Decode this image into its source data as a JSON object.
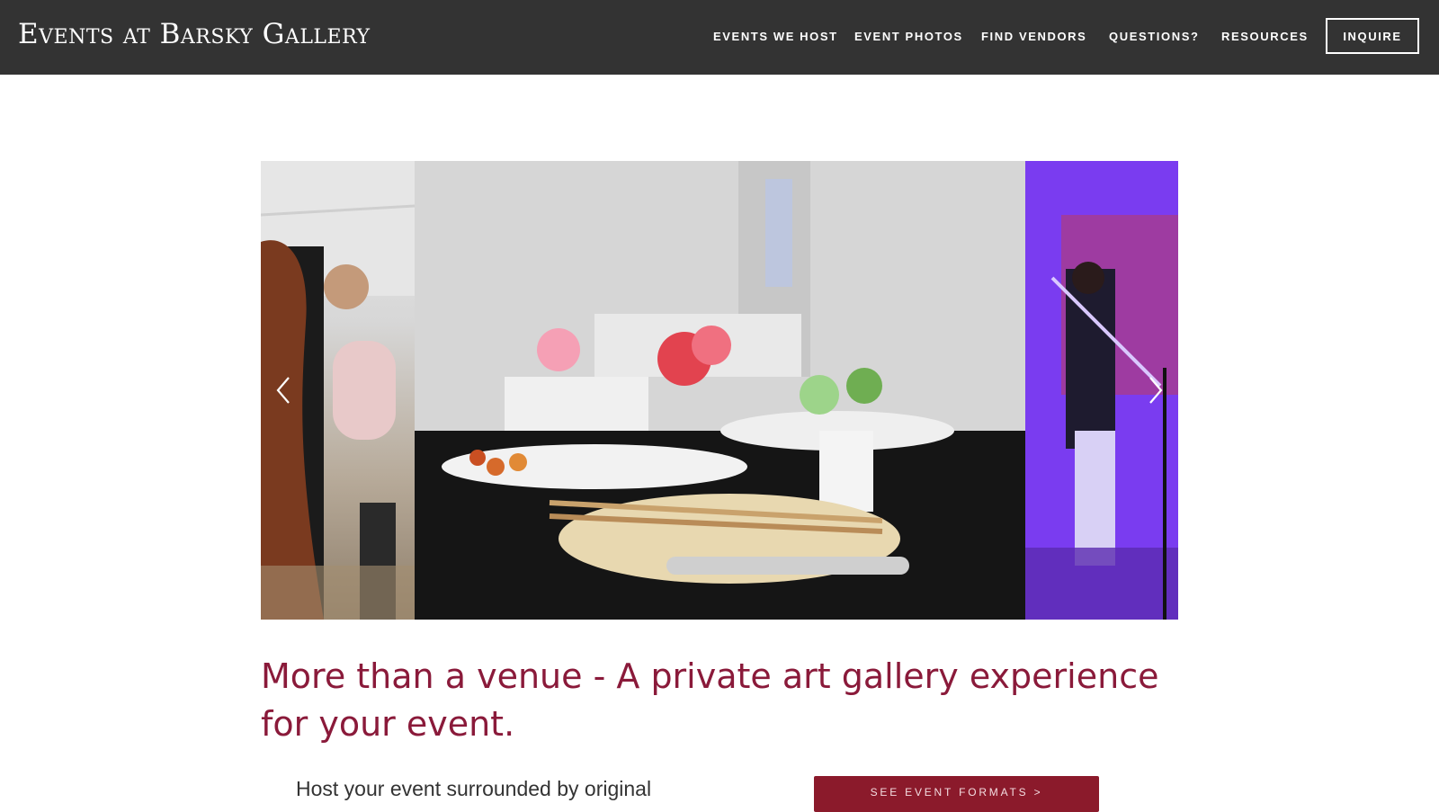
{
  "header": {
    "brand": "Events at Barsky Gallery",
    "nav": [
      {
        "label": "EVENTS WE HOST"
      },
      {
        "label": "EVENT PHOTOS"
      },
      {
        "label": "FIND VENDORS"
      },
      {
        "label": "QUESTIONS?"
      },
      {
        "label": "RESOURCES"
      }
    ],
    "inquire_label": "INQUIRE"
  },
  "carousel": {
    "slides": [
      {
        "name": "guests-seated"
      },
      {
        "name": "catering-buffet"
      },
      {
        "name": "trombone-performer"
      }
    ],
    "prev_icon": "chevron-left-icon",
    "next_icon": "chevron-right-icon"
  },
  "main": {
    "headline": "More than a venue - A private art gallery experience for your event.",
    "body_text": "Host your event surrounded by original",
    "cta_label": "SEE EVENT FORMATS >"
  },
  "colors": {
    "header_bg": "#333333",
    "headline": "#8a1a3a",
    "cta_bg": "#8b1a2b"
  }
}
